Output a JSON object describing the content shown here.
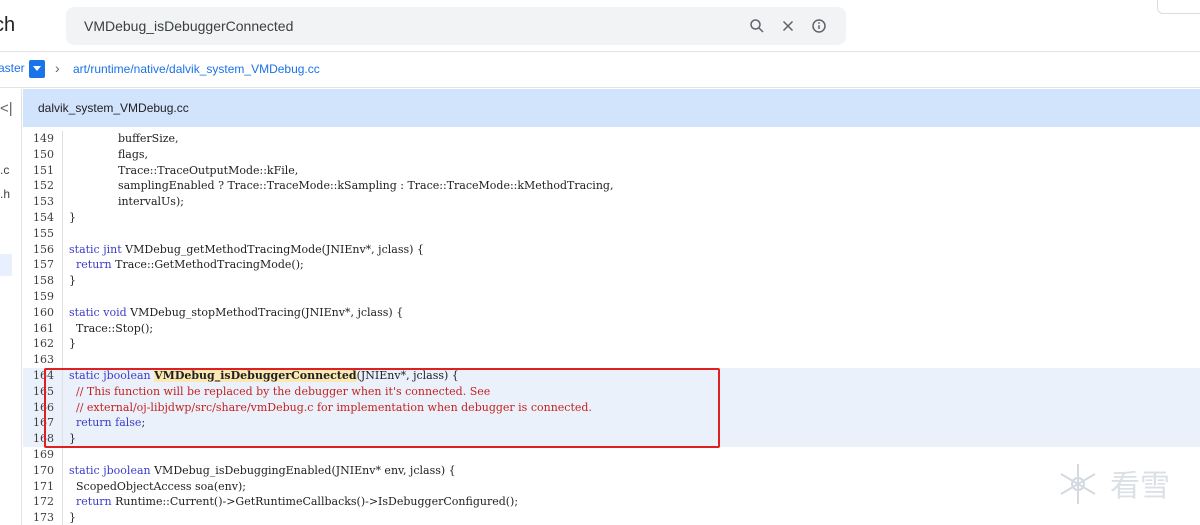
{
  "app": {
    "title": "ch"
  },
  "search": {
    "value": "VMDebug_isDebuggerConnected",
    "placeholder": ""
  },
  "breadcrumb": {
    "branch": "aster",
    "path": "art/runtime/native/dalvik_system_VMDebug.cc"
  },
  "sidebar": {
    "collapse": "<|",
    "items": [
      ".c",
      ".h"
    ]
  },
  "file": {
    "name": "dalvik_system_VMDebug.cc"
  },
  "highlight_symbol": "VMDebug_isDebuggerConnected",
  "watermark": "看雪",
  "colors": {
    "accent": "#1a73e8",
    "keyword": "#3c3cc8",
    "comment": "#c5221f",
    "selection_box": "#e02020",
    "symbol_highlight": "#fce8b2"
  },
  "code": [
    {
      "n": "149",
      "t": "              bufferSize,"
    },
    {
      "n": "150",
      "t": "              flags,"
    },
    {
      "n": "151",
      "t": "              Trace::TraceOutputMode::kFile,"
    },
    {
      "n": "152",
      "t": "              samplingEnabled ? Trace::TraceMode::kSampling : Trace::TraceMode::kMethodTracing,"
    },
    {
      "n": "153",
      "t": "              intervalUs);"
    },
    {
      "n": "154",
      "t": "}"
    },
    {
      "n": "155",
      "t": ""
    },
    {
      "n": "156",
      "t": "static jint VMDebug_getMethodTracingMode(JNIEnv*, jclass) {"
    },
    {
      "n": "157",
      "t": "  return Trace::GetMethodTracingMode();"
    },
    {
      "n": "158",
      "t": "}"
    },
    {
      "n": "159",
      "t": ""
    },
    {
      "n": "160",
      "t": "static void VMDebug_stopMethodTracing(JNIEnv*, jclass) {"
    },
    {
      "n": "161",
      "t": "  Trace::Stop();"
    },
    {
      "n": "162",
      "t": "}"
    },
    {
      "n": "163",
      "t": ""
    },
    {
      "n": "164",
      "pre": "static jboolean ",
      "sym": "VMDebug_isDebuggerConnected",
      "post": "(JNIEnv*, jclass) {"
    },
    {
      "n": "165",
      "t": "  // This function will be replaced by the debugger when it's connected. See",
      "c": true
    },
    {
      "n": "166",
      "t": "  // external/oj-libjdwp/src/share/vmDebug.c for implementation when debugger is connected.",
      "c": true
    },
    {
      "n": "167",
      "t": "  return false;"
    },
    {
      "n": "168",
      "t": "}"
    },
    {
      "n": "169",
      "t": ""
    },
    {
      "n": "170",
      "t": "static jboolean VMDebug_isDebuggingEnabled(JNIEnv* env, jclass) {"
    },
    {
      "n": "171",
      "t": "  ScopedObjectAccess soa(env);"
    },
    {
      "n": "172",
      "t": "  return Runtime::Current()->GetRuntimeCallbacks()->IsDebuggerConfigured();"
    },
    {
      "n": "173",
      "t": "}"
    }
  ]
}
